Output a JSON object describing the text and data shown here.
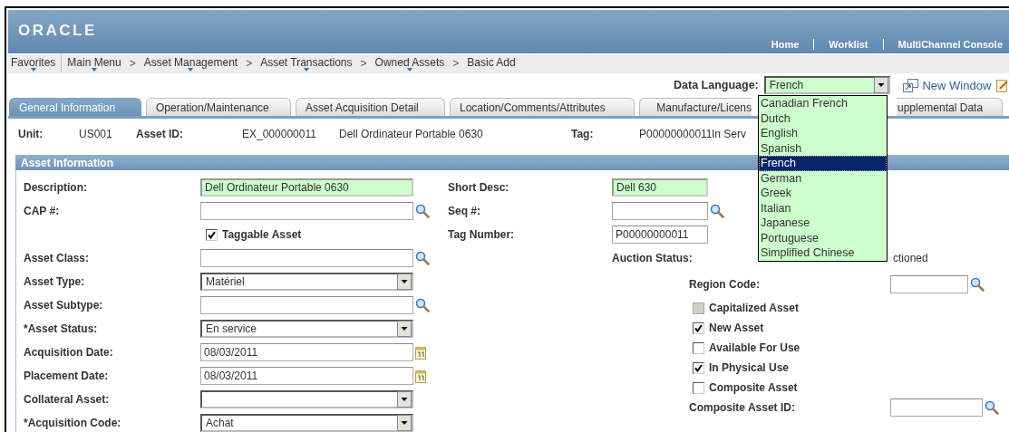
{
  "header": {
    "logo": "ORACLE",
    "links": [
      "Home",
      "Worklist",
      "MultiChannel Console"
    ]
  },
  "nav": {
    "favorites": {
      "label": "Favorites",
      "menu": true
    },
    "separator": ">",
    "breadcrumb": [
      {
        "label": "Main Menu",
        "menu": true
      },
      {
        "label": "Asset Management",
        "menu": true
      },
      {
        "label": "Asset Transactions",
        "menu": true
      },
      {
        "label": "Owned Assets",
        "menu": true
      },
      {
        "label": "Basic Add",
        "menu": false
      }
    ]
  },
  "toolbar": {
    "label": "Data Language:",
    "language": "French",
    "link": "New Window"
  },
  "language_list": [
    {
      "label": "Canadian French",
      "selected": false
    },
    {
      "label": "Dutch",
      "selected": false
    },
    {
      "label": "English",
      "selected": false
    },
    {
      "label": "Spanish",
      "selected": false
    },
    {
      "label": "French",
      "selected": true
    },
    {
      "label": "German",
      "selected": false
    },
    {
      "label": "Greek",
      "selected": false
    },
    {
      "label": "Italian",
      "selected": false
    },
    {
      "label": "Japanese",
      "selected": false
    },
    {
      "label": "Portuguese",
      "selected": false
    },
    {
      "label": "Simplified Chinese",
      "selected": false
    }
  ],
  "tabs": [
    {
      "label": "General Information",
      "selected": true
    },
    {
      "label": "Operation/Maintenance",
      "selected": false
    },
    {
      "label": "Asset Acquisition Detail",
      "selected": false
    },
    {
      "label": "Location/Comments/Attributes",
      "selected": false
    },
    {
      "label": "Manufacture/Licens",
      "selected": false
    },
    {
      "label": "upplemental Data",
      "selected": false
    }
  ],
  "summary": [
    {
      "kind": "label",
      "text": "Unit:"
    },
    {
      "kind": "value",
      "text": "US001"
    },
    {
      "kind": "label",
      "text": "Asset ID:"
    },
    {
      "kind": "value",
      "text": "EX_000000011"
    },
    {
      "kind": "value",
      "text": "Dell Ordinateur Portable 0630"
    },
    {
      "kind": "label",
      "text": "Tag:"
    },
    {
      "kind": "value",
      "text": "P00000000011"
    },
    {
      "kind": "value",
      "text": "In Serv"
    }
  ],
  "section": {
    "title": "Asset Information",
    "left": [
      {
        "kind": "text",
        "label": "Description:",
        "value": "Dell Ordinateur Portable 0630",
        "highlighted": true
      },
      {
        "kind": "lookup",
        "label": "CAP #:",
        "highlighted": false
      },
      {
        "kind": "checkbox",
        "label": "Taggable Asset",
        "checked": true,
        "disabled": false
      },
      {
        "kind": "lookup",
        "label": "Asset Class:",
        "highlighted": false
      },
      {
        "kind": "select",
        "label": "Asset Type:",
        "value": "Matériel"
      },
      {
        "kind": "lookup",
        "label": "Asset Subtype:",
        "highlighted": false
      },
      {
        "kind": "select",
        "label": "*Asset Status:",
        "value": "En service"
      },
      {
        "kind": "date",
        "label": "Acquisition Date:",
        "value": "08/03/2011",
        "highlighted": false
      },
      {
        "kind": "date",
        "label": "Placement Date:",
        "value": "08/03/2011",
        "highlighted": false
      },
      {
        "kind": "select",
        "label": "Collateral Asset:"
      },
      {
        "kind": "select",
        "label": "*Acquisition Code:",
        "value": "Achat"
      }
    ],
    "right": [
      {
        "kind": "text",
        "label": "Short Desc:",
        "value": "Dell 630",
        "highlighted": true
      },
      {
        "kind": "lookup",
        "label": "Seq #:",
        "highlighted": false
      },
      {
        "kind": "text",
        "label": "Tag Number:",
        "value": "P00000000011",
        "highlighted": false
      },
      {
        "kind": "status",
        "label": "Auction Status:",
        "value": "ctioned"
      }
    ],
    "right_lower": [
      {
        "kind": "lookup",
        "label": "Region Code:",
        "highlighted": false
      },
      {
        "kind": "checkbox",
        "label": "Capitalized Asset",
        "checked": false,
        "disabled": true
      },
      {
        "kind": "checkbox",
        "label": "New Asset",
        "checked": true,
        "disabled": false
      },
      {
        "kind": "checkbox",
        "label": "Available For Use",
        "checked": false,
        "disabled": false
      },
      {
        "kind": "checkbox",
        "label": "In Physical Use",
        "checked": true,
        "disabled": false
      },
      {
        "kind": "checkbox",
        "label": "Composite Asset",
        "checked": false,
        "disabled": false
      },
      {
        "kind": "lookup",
        "label": "Composite Asset ID:",
        "highlighted": false
      }
    ]
  }
}
